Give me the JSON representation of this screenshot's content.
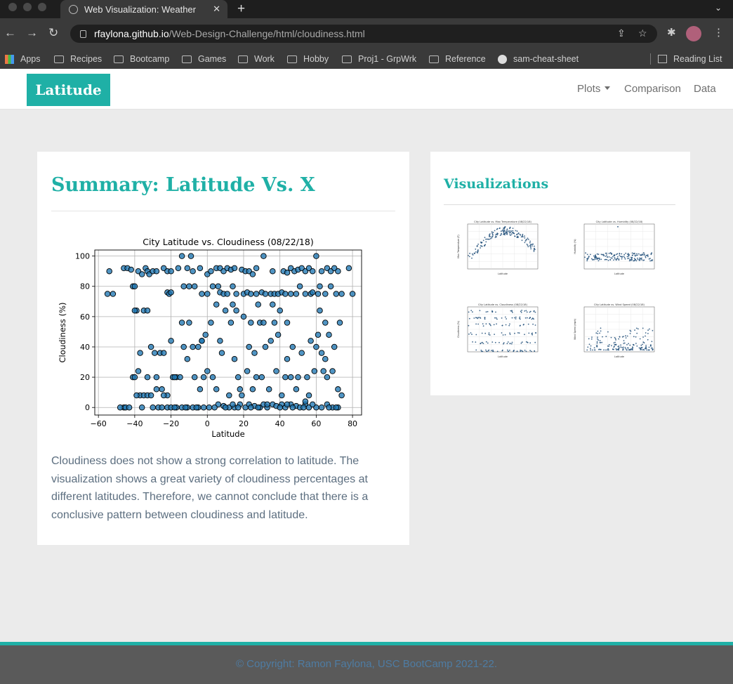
{
  "browser": {
    "tab_title": "Web Visualization: Weather",
    "url_host": "rfaylona.github.io",
    "url_path": "/Web-Design-Challenge/html/cloudiness.html",
    "bookmarks": [
      "Apps",
      "Recipes",
      "Bootcamp",
      "Games",
      "Work",
      "Hobby",
      "Proj1 - GrpWrk",
      "Reference",
      "sam-cheat-sheet"
    ],
    "reading_list": "Reading List"
  },
  "nav": {
    "brand": "Latitude",
    "plots": "Plots",
    "comparison": "Comparison",
    "data": "Data"
  },
  "main": {
    "heading": "Summary: Latitude Vs. X",
    "summary": "Cloudiness does not show a strong correlation to latitude. The visualization shows a great variety of cloudiness percentages at different latitudes. Therefore, we cannot conclude that there is a conclusive pattern between cloudiness and latitude."
  },
  "side": {
    "heading": "Visualizations",
    "thumbnails": [
      {
        "title": "City Latitude vs. Max Temperature (08/22/18)",
        "ylabel": "Max Temperature (F)",
        "xlabel": "Latitude"
      },
      {
        "title": "City Latitude vs. Humidity (08/22/18)",
        "ylabel": "Humidity (%)",
        "xlabel": "Latitude"
      },
      {
        "title": "City Latitude vs. Cloudiness (08/22/18)",
        "ylabel": "Cloudiness (%)",
        "xlabel": "Latitude"
      },
      {
        "title": "City Latitude vs. Wind Speed (08/22/18)",
        "ylabel": "Wind Speed (mph)",
        "xlabel": "Latitude"
      }
    ]
  },
  "footer": {
    "text": "© Copyright: Ramon Faylona, USC BootCamp 2021-22."
  },
  "colors": {
    "accent": "#1fb0a6",
    "marker": "#1f77b4"
  },
  "chart_data": {
    "type": "scatter",
    "title": "City Latitude vs. Cloudiness (08/22/18)",
    "xlabel": "Latitude",
    "ylabel": "Cloudiness (%)",
    "xlim": [
      -62,
      85
    ],
    "ylim": [
      -5,
      104
    ],
    "xticks": [
      -60,
      -40,
      -20,
      0,
      20,
      40,
      60,
      80
    ],
    "yticks": [
      0,
      20,
      40,
      60,
      80,
      100
    ],
    "grid": true,
    "points": [
      [
        -55,
        75
      ],
      [
        -52,
        75
      ],
      [
        -54,
        90
      ],
      [
        -46,
        92
      ],
      [
        -44,
        92
      ],
      [
        -42,
        91
      ],
      [
        -41,
        80
      ],
      [
        -40,
        80
      ],
      [
        -39,
        64
      ],
      [
        -38,
        90
      ],
      [
        -36,
        88
      ],
      [
        -34,
        92
      ],
      [
        -33,
        90
      ],
      [
        -32,
        88
      ],
      [
        -35,
        64
      ],
      [
        -33,
        64
      ],
      [
        -30,
        90
      ],
      [
        -28,
        90
      ],
      [
        -24,
        92
      ],
      [
        -22,
        90
      ],
      [
        -20,
        90
      ],
      [
        -16,
        92
      ],
      [
        -14,
        100
      ],
      [
        -11,
        92
      ],
      [
        -9,
        100
      ],
      [
        -8,
        90
      ],
      [
        -4,
        92
      ],
      [
        0,
        88
      ],
      [
        2,
        90
      ],
      [
        5,
        92
      ],
      [
        7,
        92
      ],
      [
        9,
        90
      ],
      [
        11,
        92
      ],
      [
        13,
        91
      ],
      [
        15,
        92
      ],
      [
        19,
        91
      ],
      [
        21,
        90
      ],
      [
        23,
        90
      ],
      [
        25,
        88
      ],
      [
        27,
        92
      ],
      [
        31,
        100
      ],
      [
        36,
        90
      ],
      [
        42,
        90
      ],
      [
        44,
        89
      ],
      [
        46,
        92
      ],
      [
        48,
        90
      ],
      [
        50,
        91
      ],
      [
        52,
        92
      ],
      [
        54,
        90
      ],
      [
        56,
        92
      ],
      [
        58,
        90
      ],
      [
        60,
        100
      ],
      [
        63,
        90
      ],
      [
        66,
        92
      ],
      [
        68,
        90
      ],
      [
        70,
        92
      ],
      [
        72,
        90
      ],
      [
        78,
        92
      ],
      [
        -22,
        76
      ],
      [
        -21,
        75
      ],
      [
        -20,
        76
      ],
      [
        -13,
        80
      ],
      [
        -10,
        80
      ],
      [
        -7,
        80
      ],
      [
        -3,
        75
      ],
      [
        0,
        75
      ],
      [
        3,
        80
      ],
      [
        6,
        80
      ],
      [
        7,
        76
      ],
      [
        9,
        75
      ],
      [
        11,
        75
      ],
      [
        14,
        80
      ],
      [
        16,
        75
      ],
      [
        20,
        75
      ],
      [
        22,
        76
      ],
      [
        24,
        75
      ],
      [
        27,
        75
      ],
      [
        30,
        76
      ],
      [
        32,
        75
      ],
      [
        35,
        75
      ],
      [
        37,
        75
      ],
      [
        39,
        75
      ],
      [
        41,
        76
      ],
      [
        43,
        75
      ],
      [
        46,
        75
      ],
      [
        49,
        75
      ],
      [
        51,
        80
      ],
      [
        54,
        75
      ],
      [
        57,
        75
      ],
      [
        61,
        75
      ],
      [
        62,
        80
      ],
      [
        65,
        75
      ],
      [
        68,
        80
      ],
      [
        71,
        75
      ],
      [
        74,
        75
      ],
      [
        80,
        75
      ],
      [
        -46,
        0
      ],
      [
        -45,
        0
      ],
      [
        -41,
        20
      ],
      [
        -40,
        20
      ],
      [
        -37,
        8
      ],
      [
        -35,
        8
      ],
      [
        -33,
        8
      ],
      [
        -31,
        8
      ],
      [
        -30,
        0
      ],
      [
        -27,
        0
      ],
      [
        -25,
        0
      ],
      [
        -22,
        0
      ],
      [
        -20,
        0
      ],
      [
        -17,
        0
      ],
      [
        -14,
        0
      ],
      [
        -11,
        0
      ],
      [
        -8,
        0
      ],
      [
        -5,
        0
      ],
      [
        -2,
        0
      ],
      [
        1,
        0
      ],
      [
        6,
        2
      ],
      [
        9,
        1
      ],
      [
        12,
        0
      ],
      [
        15,
        0
      ],
      [
        18,
        2
      ],
      [
        21,
        0
      ],
      [
        23,
        2
      ],
      [
        26,
        1
      ],
      [
        29,
        0
      ],
      [
        31,
        2
      ],
      [
        33,
        0
      ],
      [
        36,
        2
      ],
      [
        38,
        1
      ],
      [
        41,
        2
      ],
      [
        43,
        0
      ],
      [
        46,
        2
      ],
      [
        49,
        1
      ],
      [
        51,
        0
      ],
      [
        54,
        2
      ],
      [
        56,
        0
      ],
      [
        60,
        0
      ],
      [
        66,
        2
      ],
      [
        69,
        0
      ],
      [
        72,
        0
      ],
      [
        -39,
        8
      ],
      [
        -38,
        24
      ],
      [
        -37,
        36
      ],
      [
        -33,
        20
      ],
      [
        -31,
        40
      ],
      [
        -28,
        20
      ],
      [
        -26,
        36
      ],
      [
        -22,
        8
      ],
      [
        -20,
        44
      ],
      [
        -19,
        20
      ],
      [
        -17,
        20
      ],
      [
        -15,
        20
      ],
      [
        -14,
        56
      ],
      [
        -13,
        40
      ],
      [
        -11,
        32
      ],
      [
        -10,
        56
      ],
      [
        -8,
        40
      ],
      [
        -7,
        20
      ],
      [
        -5,
        40
      ],
      [
        -3,
        44
      ],
      [
        -1,
        48
      ],
      [
        0,
        24
      ],
      [
        2,
        56
      ],
      [
        3,
        20
      ],
      [
        5,
        12
      ],
      [
        7,
        44
      ],
      [
        8,
        36
      ],
      [
        10,
        64
      ],
      [
        12,
        8
      ],
      [
        13,
        56
      ],
      [
        15,
        32
      ],
      [
        16,
        64
      ],
      [
        17,
        20
      ],
      [
        19,
        8
      ],
      [
        20,
        60
      ],
      [
        22,
        24
      ],
      [
        23,
        40
      ],
      [
        25,
        12
      ],
      [
        26,
        36
      ],
      [
        28,
        68
      ],
      [
        29,
        56
      ],
      [
        30,
        20
      ],
      [
        32,
        40
      ],
      [
        34,
        12
      ],
      [
        35,
        44
      ],
      [
        37,
        56
      ],
      [
        38,
        24
      ],
      [
        40,
        64
      ],
      [
        41,
        8
      ],
      [
        43,
        20
      ],
      [
        44,
        32
      ],
      [
        46,
        20
      ],
      [
        47,
        40
      ],
      [
        49,
        12
      ],
      [
        50,
        20
      ],
      [
        52,
        36
      ],
      [
        54,
        4
      ],
      [
        55,
        20
      ],
      [
        56,
        8
      ],
      [
        57,
        44
      ],
      [
        59,
        24
      ],
      [
        61,
        48
      ],
      [
        62,
        64
      ],
      [
        63,
        36
      ],
      [
        65,
        32
      ],
      [
        66,
        20
      ],
      [
        67,
        48
      ],
      [
        69,
        24
      ],
      [
        70,
        40
      ],
      [
        72,
        12
      ],
      [
        73,
        56
      ],
      [
        74,
        8
      ],
      [
        -48,
        0
      ],
      [
        -43,
        0
      ],
      [
        -36,
        0
      ],
      [
        -28,
        12
      ],
      [
        -24,
        8
      ],
      [
        -18,
        0
      ],
      [
        -12,
        0
      ],
      [
        -6,
        0
      ],
      [
        -4,
        12
      ],
      [
        4,
        0
      ],
      [
        10,
        0
      ],
      [
        14,
        2
      ],
      [
        17,
        0
      ],
      [
        24,
        0
      ],
      [
        28,
        0
      ],
      [
        33,
        2
      ],
      [
        40,
        0
      ],
      [
        44,
        2
      ],
      [
        47,
        0
      ],
      [
        53,
        0
      ],
      [
        58,
        2
      ],
      [
        63,
        0
      ],
      [
        67,
        0
      ],
      [
        71,
        0
      ],
      [
        -24,
        36
      ],
      [
        -18,
        20
      ],
      [
        -2,
        20
      ],
      [
        5,
        68
      ],
      [
        14,
        68
      ],
      [
        24,
        56
      ],
      [
        39,
        48
      ],
      [
        44,
        56
      ],
      [
        58,
        76
      ],
      [
        64,
        24
      ],
      [
        -40,
        64
      ],
      [
        -29,
        36
      ],
      [
        -25,
        12
      ],
      [
        -3,
        44
      ],
      [
        18,
        12
      ],
      [
        27,
        20
      ],
      [
        31,
        56
      ],
      [
        36,
        68
      ],
      [
        60,
        40
      ],
      [
        65,
        56
      ]
    ]
  }
}
